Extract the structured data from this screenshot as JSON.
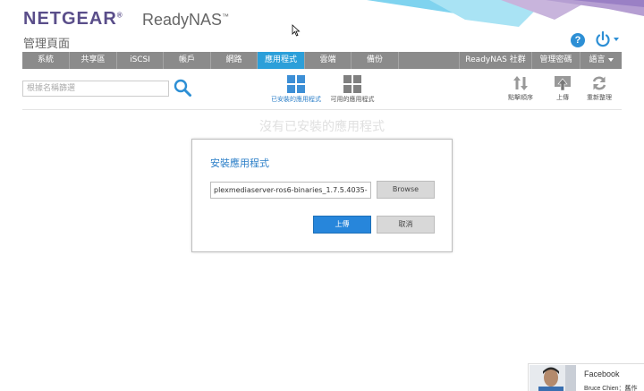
{
  "header": {
    "brand": "NETGEAR",
    "brand_mark": "®",
    "product": "ReadyNAS",
    "product_mark": "™",
    "page_title": "管理頁面",
    "help_icon_glyph": "?"
  },
  "nav": {
    "items": [
      {
        "label": "系統"
      },
      {
        "label": "共享區"
      },
      {
        "label": "iSCSI"
      },
      {
        "label": "帳戶"
      },
      {
        "label": "網路"
      },
      {
        "label": "應用程式",
        "active": true
      },
      {
        "label": "雲端"
      },
      {
        "label": "備份"
      }
    ],
    "right_items": [
      {
        "label": "ReadyNAS 社群"
      },
      {
        "label": "管理密碼"
      },
      {
        "label": "語言"
      }
    ]
  },
  "toolbar": {
    "search_placeholder": "根據名稱篩選",
    "tab_installed": "已安裝的應用程式",
    "tab_available": "可用的應用程式",
    "sort_label": "點擊順序",
    "upload_label": "上傳",
    "refresh_label": "重新整理"
  },
  "main": {
    "empty_message": "沒有已安裝的應用程式"
  },
  "dialog": {
    "title": "安裝應用程式",
    "file_value": "plexmediaserver-ros6-binaries_1.7.5.4035-",
    "browse_label": "Browse",
    "upload_label": "上傳",
    "cancel_label": "取消"
  },
  "facebook": {
    "title": "Facebook",
    "subtitle": "Bruce Chien：舊作"
  },
  "colors": {
    "accent": "#2c9fd9",
    "nav_bg": "#8b8b8b",
    "brand": "#5a4e8a",
    "primary_button": "#2786db"
  }
}
